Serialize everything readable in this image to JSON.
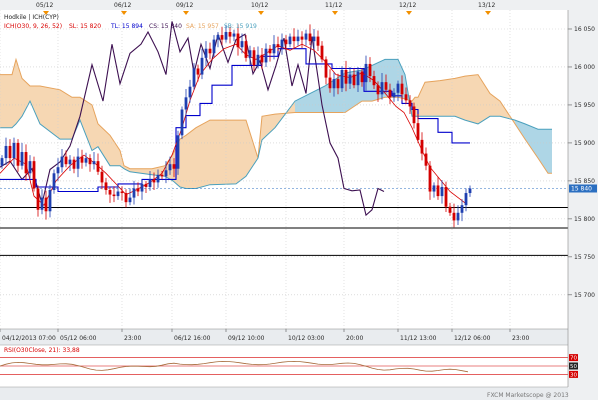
{
  "instrument": "Hodkile | ICH(CYP)",
  "ichimoku_legend": {
    "name": "ICH(O30, 9, 26, 52)",
    "sl": "SL: 15 820",
    "tl": "TL: 15 894",
    "cs": "CS: 15 840",
    "sa": "SA: 15 957",
    "sb": "SB: 15 919"
  },
  "rsi_legend": "RSI(O30Close, 21): 33,88",
  "footer": "FXCM Marketscope @ 2013",
  "colors": {
    "cloud_bull": "#aed6e6",
    "cloud_bear": "#f6d7b3",
    "span_a": "#e6a35c",
    "span_b": "#4aa0bd",
    "tenkan": "#d90000",
    "kijun": "#0000cc",
    "chikou": "#3d1051",
    "candle_up": "#1f3fb0",
    "candle_down": "#d40000",
    "rsi_line": "#a66a3a",
    "rsi_level": "#d40000",
    "price_marker": "#2b6fc1",
    "panel_bg": "#e9ecef",
    "hline": "#000000",
    "date_marker": "#f29000"
  },
  "chart_data": [
    {
      "type": "candlestick",
      "overlay": "ichimoku",
      "top_date_labels": [
        "05/12",
        "06/12",
        "09/12",
        "10/12",
        "11/12",
        "12/12",
        "13/12"
      ],
      "bottom_time_labels": [
        "04/12/2013 07:00",
        "05/12 06:00",
        "23:00",
        "06/12 16:00",
        "09/12 10:00",
        "10/12 03:00",
        "20:00",
        "11/12 13:00",
        "12/12 06:00",
        "23:00"
      ],
      "y_tick_labels": [
        "16 050",
        "16 000",
        "15 950",
        "15 900",
        "15 850",
        "15 800",
        "15 750",
        "15 700"
      ],
      "y_ticks": [
        16050,
        16000,
        15950,
        15900,
        15850,
        15800,
        15750,
        15700
      ],
      "ylim": [
        15655,
        16075
      ],
      "current_price": 15840,
      "current_price_label": "15 840",
      "horizontal_lines": [
        15815,
        15788,
        15752
      ],
      "tenkan_sen_value": 15820,
      "kijun_sen_value": 15894,
      "chikou_span_value": 15840,
      "senkou_span_a_value": 15957,
      "senkou_span_b_value": 15919
    },
    {
      "type": "line",
      "name": "RSI",
      "period": 21,
      "value": 33.88,
      "levels": [
        70,
        50,
        30
      ],
      "level_labels": [
        "70",
        "50",
        "30"
      ],
      "ylim": [
        0,
        100
      ]
    }
  ]
}
